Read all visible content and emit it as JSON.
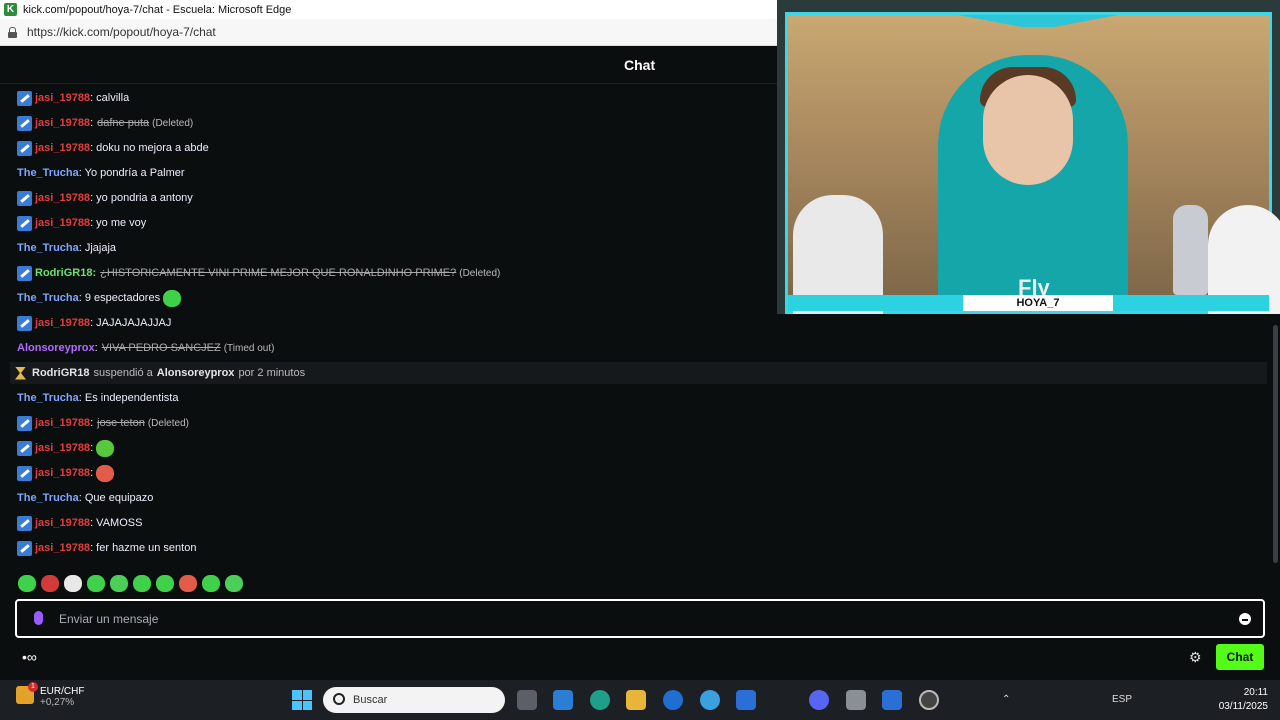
{
  "browser": {
    "title": "kick.com/popout/hoya-7/chat - Escuela: Microsoft Edge",
    "url": "https://kick.com/popout/hoya-7/chat",
    "logo_letter": "K"
  },
  "chat": {
    "header": "Chat",
    "input_placeholder": "Enviar un mensaje",
    "send_button": "Chat",
    "footer_icons": "•∞"
  },
  "video": {
    "streamer_name": "HOYA_7",
    "shirt_text": "Fly"
  },
  "colors": {
    "jasi": "#e33d3d",
    "trucha": "#7fa6ff",
    "rodri": "#6be36b",
    "alonso": "#b46cff",
    "accent": "#53fc18"
  },
  "messages": [
    {
      "user": "jasi_19788",
      "text": ": calvilla"
    },
    {
      "user": "jasi_19788",
      "sep": ":",
      "text": "dafne puta",
      "tag": "(Deleted)"
    },
    {
      "user": "jasi_19788",
      "text": ": doku no mejora a abde"
    },
    {
      "user": "The_Trucha",
      "text": ": Yo pondría a Palmer"
    },
    {
      "user": "jasi_19788",
      "text": ": yo pondria a antony"
    },
    {
      "user": "jasi_19788",
      "text": ": yo me voy"
    },
    {
      "user": "The_Trucha",
      "text": ": Jjajaja"
    },
    {
      "user": "RodriGR18:",
      "text": "¿HISTORICAMENTE VINI PRIME MEJOR QUE RONALDINHO PRIME?",
      "tag": "(Deleted)"
    },
    {
      "user": "The_Trucha",
      "text": ": 9 espectadores"
    },
    {
      "user": "jasi_19788",
      "text": ": JAJAJAJAJJAJ"
    },
    {
      "user": "Alonsoreyprox",
      "sep": ":",
      "text": "VIVA PEDRO SANCJEZ",
      "tag": "(Timed out)"
    },
    {
      "system": {
        "actor": "RodriGR18",
        "verb": "suspendió a",
        "target": "Alonsoreyprox",
        "suffix": "por 2 minutos"
      }
    },
    {
      "user": "The_Trucha",
      "text": ": Es independentista"
    },
    {
      "user": "jasi_19788",
      "sep": ":",
      "text": "jose teton",
      "tag": "(Deleted)"
    },
    {
      "user": "jasi_19788",
      "text": ":"
    },
    {
      "user": "jasi_19788",
      "text": ":"
    },
    {
      "user": "The_Trucha",
      "text": ": Que equipazo"
    },
    {
      "user": "jasi_19788",
      "text": ": VAMOSS"
    },
    {
      "user": "jasi_19788",
      "text": ": fer hazme un senton"
    }
  ],
  "taskbar": {
    "stock_name": "EUR/CHF",
    "stock_change": "+0,27%",
    "stock_badge": "1",
    "search_placeholder": "Buscar",
    "lang": "ESP",
    "time": "20:11",
    "date": "03/11/2025"
  }
}
